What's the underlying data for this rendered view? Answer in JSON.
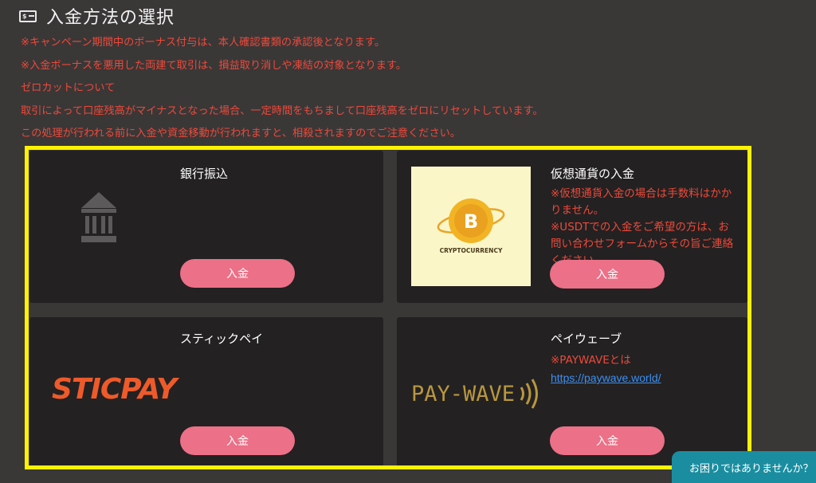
{
  "header": {
    "icon": "money-bill-icon",
    "icon_text": "$",
    "title": "入金方法の選択"
  },
  "notices": [
    "※キャンペーン期間中のボーナス付与は、本人確認書類の承認後となります。",
    "※入金ボーナスを悪用した両建て取引は、損益取り消しや凍結の対象となります。",
    "ゼロカットについて",
    "取引によって口座残高がマイナスとなった場合、一定時間をもちまして口座残高をゼロにリセットしています。",
    "この処理が行われる前に入金や資金移動が行われますと、相殺されますのでご注意ください。"
  ],
  "methods": {
    "bank": {
      "title": "銀行振込",
      "icon": "bank-icon",
      "button": "入金"
    },
    "crypto": {
      "title": "仮想通貨の入金",
      "logo_coin": "B",
      "logo_text": "CRYPTOCURRENCY",
      "note": "※仮想通貨入金の場合は手数料はかかりません。\n※USDTでの入金をご希望の方は、お問い合わせフォームからその旨ご連絡ください。",
      "button": "入金"
    },
    "sticpay": {
      "title": "スティックペイ",
      "logo_text": "STICPAY",
      "button": "入金"
    },
    "paywave": {
      "title": "ペイウェーブ",
      "logo_text": "PAY-WAVE",
      "note": "※PAYWAVEとは",
      "link": "https://paywave.world/",
      "button": "入金"
    }
  },
  "help_tab": "お困りではありませんか？",
  "colors": {
    "background": "#3a3737",
    "card": "#232122",
    "notice_red": "#ec4a3a",
    "button_pink": "#ec7087",
    "highlight_yellow": "#fff200",
    "help_teal": "#1a8ea0",
    "link_blue": "#3d8ff0"
  }
}
